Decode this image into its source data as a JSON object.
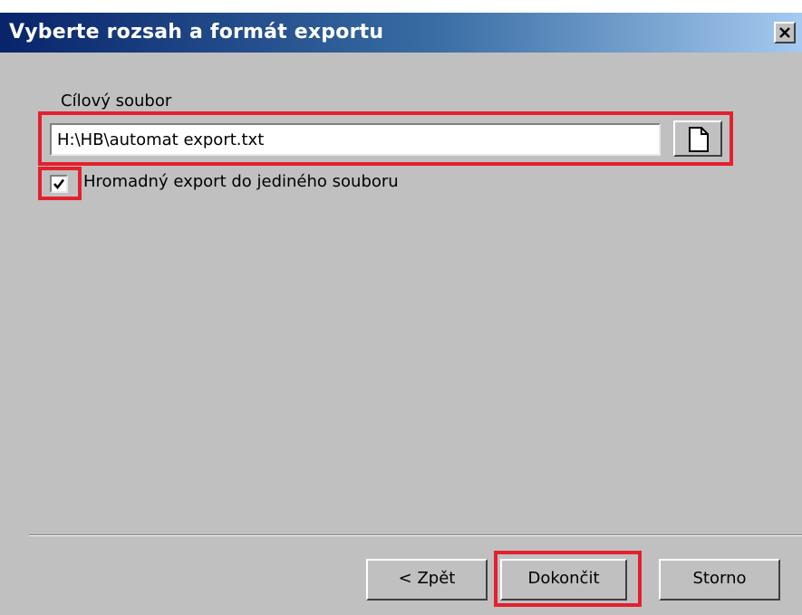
{
  "dialog": {
    "title": "Vyberte rozsah a formát exportu",
    "close_glyph": "✕"
  },
  "target_file": {
    "label": "Cílový soubor",
    "value": "H:\\HB\\automat export.txt",
    "browse_icon": "document-icon"
  },
  "bulk_export": {
    "label": "Hromadný export do jediného souboru",
    "checked": true
  },
  "buttons": {
    "back": "< Zpět",
    "finish": "Dokončit",
    "cancel": "Storno"
  },
  "colors": {
    "highlight": "#e4202e",
    "titlebar_start": "#08246b",
    "titlebar_end": "#a6caf0",
    "face": "#c0c0c0"
  }
}
